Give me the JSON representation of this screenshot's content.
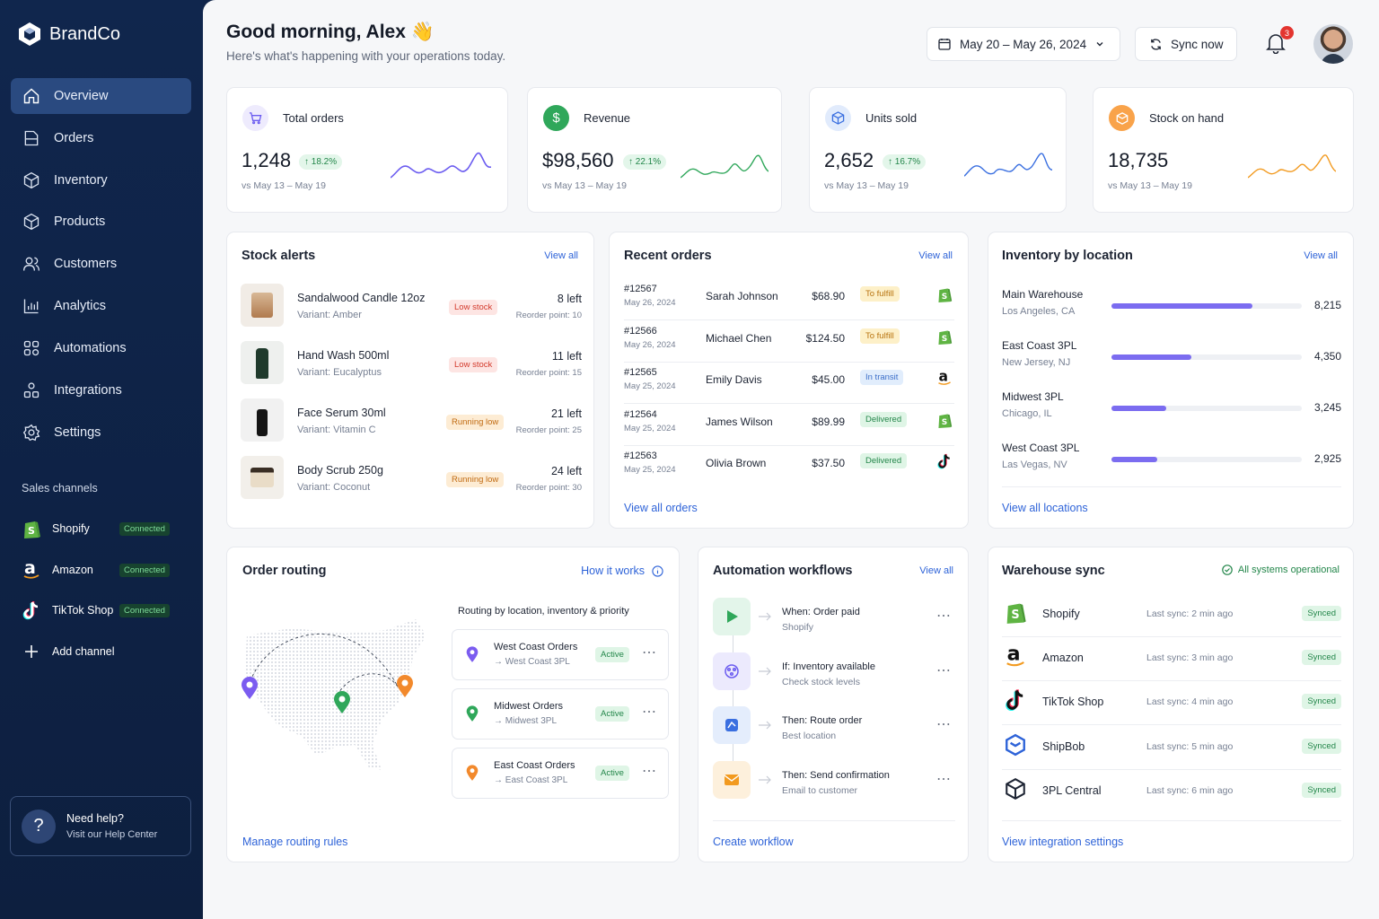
{
  "brand": {
    "name": "BrandCo"
  },
  "nav": [
    {
      "label": "Overview",
      "icon": "home-icon"
    },
    {
      "label": "Orders",
      "icon": "orders-icon"
    },
    {
      "label": "Inventory",
      "icon": "box-icon"
    },
    {
      "label": "Products",
      "icon": "cube-icon"
    },
    {
      "label": "Customers",
      "icon": "users-icon"
    },
    {
      "label": "Analytics",
      "icon": "chart-icon"
    },
    {
      "label": "Automations",
      "icon": "automation-icon"
    },
    {
      "label": "Integrations",
      "icon": "integrations-icon"
    },
    {
      "label": "Settings",
      "icon": "gear-icon"
    }
  ],
  "sales_channels": {
    "label": "Sales channels",
    "items": [
      {
        "name": "Shopify",
        "status": "Connected"
      },
      {
        "name": "Amazon",
        "status": "Connected"
      },
      {
        "name": "TikTok Shop",
        "status": "Connected"
      }
    ],
    "add_label": "Add channel"
  },
  "help": {
    "title": "Need help?",
    "subtitle": "Visit our Help Center"
  },
  "header": {
    "greeting": "Good morning, Alex 👋",
    "subtitle": "Here's what's happening with your operations today.",
    "date_range": "May 20 – May 26, 2024",
    "sync_label": "Sync now",
    "notif_count": "3"
  },
  "kpis": [
    {
      "label": "Total orders",
      "value": "1,248",
      "delta": "↑ 18.2%",
      "compare": "vs May 13 – May 19",
      "color": "#6b5cf0"
    },
    {
      "label": "Revenue",
      "value": "$98,560",
      "delta": "↑ 22.1%",
      "compare": "vs May 13 – May 19",
      "color": "#2fa75a"
    },
    {
      "label": "Units sold",
      "value": "2,652",
      "delta": "↑ 16.7%",
      "compare": "vs May 13 – May 19",
      "color": "#3a6fe0"
    },
    {
      "label": "Stock on hand",
      "value": "18,735",
      "delta": "",
      "compare": "vs May 13 – May 19",
      "color": "#f29a1f"
    }
  ],
  "stock_alerts": {
    "title": "Stock alerts",
    "view_all": "View all",
    "items": [
      {
        "name": "Sandalwood Candle 12oz",
        "variant": "Variant: Amber",
        "status": "Low stock",
        "left": "8 left",
        "reorder": "Reorder point: 10"
      },
      {
        "name": "Hand Wash 500ml",
        "variant": "Variant: Eucalyptus",
        "status": "Low stock",
        "left": "11 left",
        "reorder": "Reorder point: 15"
      },
      {
        "name": "Face Serum 30ml",
        "variant": "Variant: Vitamin C",
        "status": "Running low",
        "left": "21 left",
        "reorder": "Reorder point: 25"
      },
      {
        "name": "Body Scrub 250g",
        "variant": "Variant: Coconut",
        "status": "Running low",
        "left": "24 left",
        "reorder": "Reorder point: 30"
      }
    ]
  },
  "recent_orders": {
    "title": "Recent orders",
    "view_all": "View all",
    "footer": "View all orders",
    "items": [
      {
        "id": "#12567",
        "date": "May 26, 2024",
        "customer": "Sarah Johnson",
        "amount": "$68.90",
        "status": "To fulfill",
        "channel": "shopify"
      },
      {
        "id": "#12566",
        "date": "May 26, 2024",
        "customer": "Michael Chen",
        "amount": "$124.50",
        "status": "To fulfill",
        "channel": "shopify"
      },
      {
        "id": "#12565",
        "date": "May 25, 2024",
        "customer": "Emily Davis",
        "amount": "$45.00",
        "status": "In transit",
        "channel": "amazon"
      },
      {
        "id": "#12564",
        "date": "May 25, 2024",
        "customer": "James Wilson",
        "amount": "$89.99",
        "status": "Delivered",
        "channel": "shopify"
      },
      {
        "id": "#12563",
        "date": "May 25, 2024",
        "customer": "Olivia Brown",
        "amount": "$37.50",
        "status": "Delivered",
        "channel": "tiktok"
      }
    ]
  },
  "inventory_location": {
    "title": "Inventory by location",
    "view_all": "View all",
    "footer": "View all locations",
    "items": [
      {
        "name": "Main Warehouse",
        "place": "Los Angeles, CA",
        "value": "8,215",
        "fraction": 0.74
      },
      {
        "name": "East Coast 3PL",
        "place": "New Jersey, NJ",
        "value": "4,350",
        "fraction": 0.42
      },
      {
        "name": "Midwest 3PL",
        "place": "Chicago, IL",
        "value": "3,245",
        "fraction": 0.29
      },
      {
        "name": "West Coast 3PL",
        "place": "Las Vegas, NV",
        "value": "2,925",
        "fraction": 0.24
      }
    ]
  },
  "order_routing": {
    "title": "Order routing",
    "how": "How it works",
    "subtitle": "Routing by location, inventory & priority",
    "footer": "Manage routing rules",
    "rules": [
      {
        "name": "West Coast Orders",
        "target": "West Coast 3PL",
        "status": "Active",
        "color": "#7b5cf0"
      },
      {
        "name": "Midwest Orders",
        "target": "Midwest 3PL",
        "status": "Active",
        "color": "#2fa75a"
      },
      {
        "name": "East Coast Orders",
        "target": "East Coast 3PL",
        "status": "Active",
        "color": "#f2892c"
      }
    ]
  },
  "automation": {
    "title": "Automation workflows",
    "view_all": "View all",
    "footer": "Create workflow",
    "steps": [
      {
        "title": "When: Order paid",
        "sub": "Shopify",
        "color": "#e3f5ea",
        "icon": "play-icon"
      },
      {
        "title": "If: Inventory available",
        "sub": "Check stock levels",
        "color": "#eceafd",
        "icon": "inventory-check-icon"
      },
      {
        "title": "Then: Route order",
        "sub": "Best location",
        "color": "#e4edfc",
        "icon": "route-icon"
      },
      {
        "title": "Then: Send confirmation",
        "sub": "Email to customer",
        "color": "#fdf0dc",
        "icon": "mail-icon"
      }
    ]
  },
  "warehouse_sync": {
    "title": "Warehouse sync",
    "status": "All systems operational",
    "footer": "View integration settings",
    "items": [
      {
        "name": "Shopify",
        "last": "Last sync: 2 min ago",
        "status": "Synced"
      },
      {
        "name": "Amazon",
        "last": "Last sync: 3 min ago",
        "status": "Synced"
      },
      {
        "name": "TikTok Shop",
        "last": "Last sync: 4 min ago",
        "status": "Synced"
      },
      {
        "name": "ShipBob",
        "last": "Last sync: 5 min ago",
        "status": "Synced"
      },
      {
        "name": "3PL Central",
        "last": "Last sync: 6 min ago",
        "status": "Synced"
      }
    ]
  }
}
